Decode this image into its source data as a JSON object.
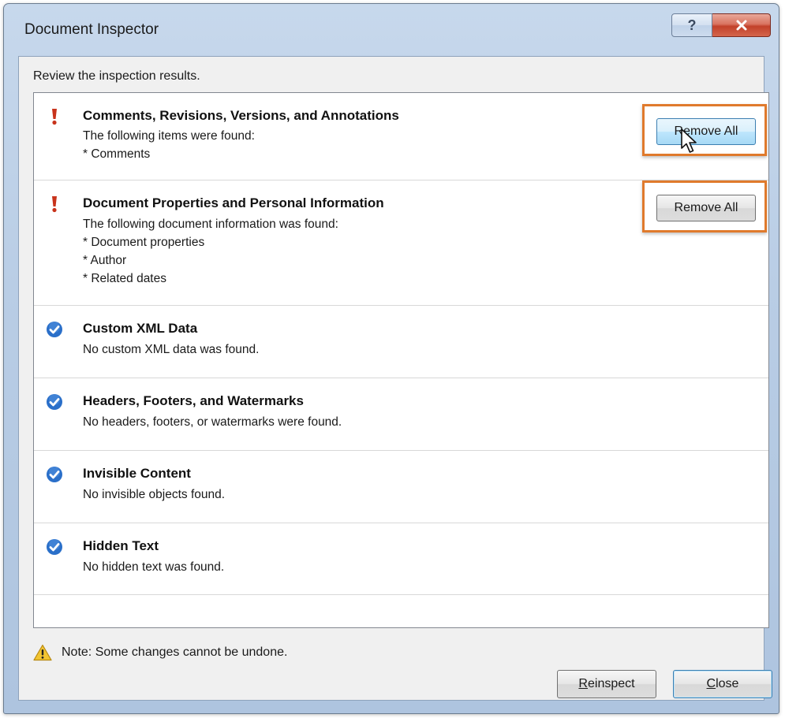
{
  "window": {
    "title": "Document Inspector",
    "help_glyph": "?",
    "close_glyph": "X"
  },
  "instruction": "Review the inspection results.",
  "results": [
    {
      "status": "found",
      "icon": "exclamation-icon",
      "title": "Comments, Revisions, Versions, and Annotations",
      "lines": [
        "The following items were found:",
        "* Comments"
      ],
      "button": "Remove All"
    },
    {
      "status": "found",
      "icon": "exclamation-icon",
      "title": "Document Properties and Personal Information",
      "lines": [
        "The following document information was found:",
        "* Document properties",
        "* Author",
        "* Related dates"
      ],
      "button": "Remove All"
    },
    {
      "status": "ok",
      "icon": "checkmark-icon",
      "title": "Custom XML Data",
      "lines": [
        "No custom XML data was found."
      ]
    },
    {
      "status": "ok",
      "icon": "checkmark-icon",
      "title": "Headers, Footers, and Watermarks",
      "lines": [
        "No headers, footers, or watermarks were found."
      ]
    },
    {
      "status": "ok",
      "icon": "checkmark-icon",
      "title": "Invisible Content",
      "lines": [
        "No invisible objects found."
      ]
    },
    {
      "status": "ok",
      "icon": "checkmark-icon",
      "title": "Hidden Text",
      "lines": [
        "No hidden text was found."
      ]
    }
  ],
  "note": {
    "icon": "warning-icon",
    "text": "Note: Some changes cannot be undone."
  },
  "footer": {
    "reinspect_label": "Reinspect",
    "reinspect_accesskey": "R",
    "reinspect_rest": "einspect",
    "close_label": "Close",
    "close_accesskey": "C",
    "close_rest": "lose"
  },
  "colors": {
    "highlight": "#e07a2c",
    "found_icon": "#c8331b",
    "ok_icon": "#2a6fc9",
    "warning": "#f2c531"
  }
}
